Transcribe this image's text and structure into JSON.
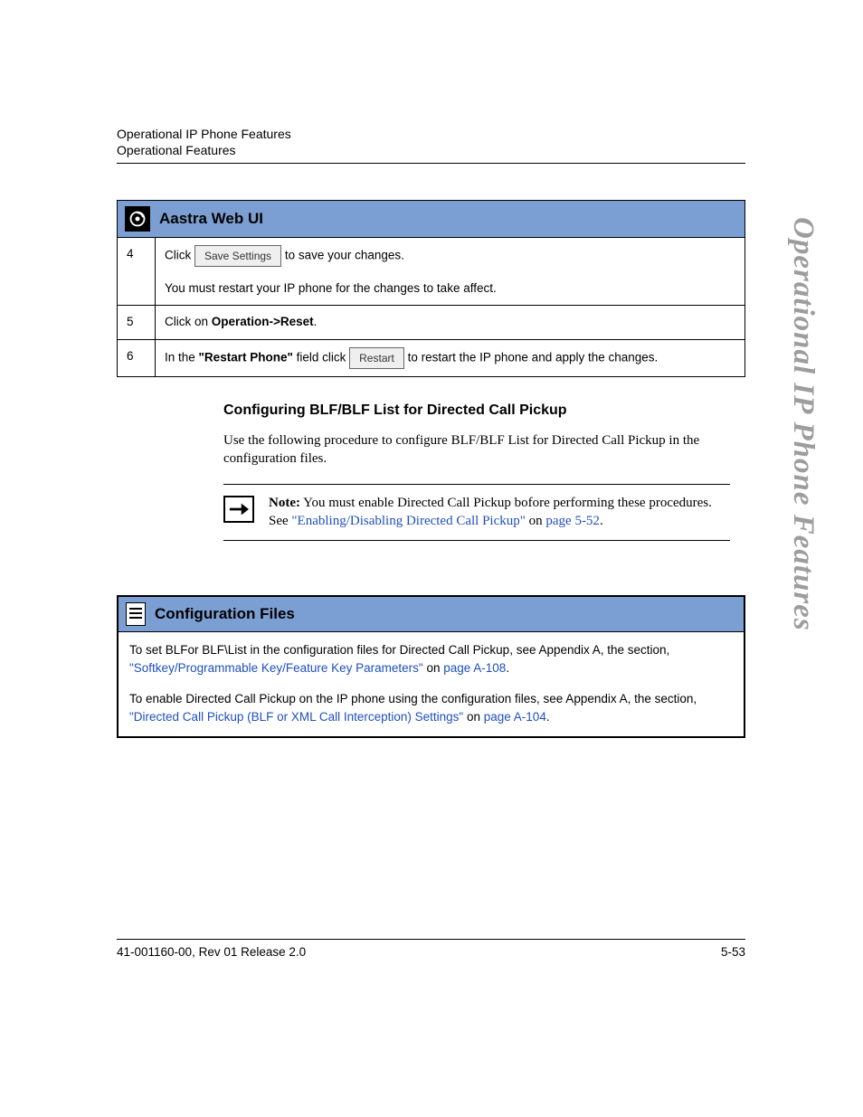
{
  "header": {
    "line1": "Operational IP Phone Features",
    "line2": "Operational Features"
  },
  "side_tab": "Operational IP Phone Features",
  "aastra_table": {
    "title": "Aastra Web UI",
    "rows": [
      {
        "num": "4",
        "prefix": "Click ",
        "button": "Save Settings",
        "after_button": " to save your changes.",
        "second_line": "You must restart your IP phone for the changes to take affect."
      },
      {
        "num": "5",
        "text_before_bold": "Click on ",
        "bold": "Operation->Reset",
        "text_after_bold": "."
      },
      {
        "num": "6",
        "text_before_bold": "In the ",
        "bold": "\"Restart Phone\"",
        "text_after_bold": " field click ",
        "button": "Restart",
        "after_button": " to restart the IP phone and apply the changes."
      }
    ]
  },
  "section": {
    "heading": "Configuring BLF/BLF List for Directed Call Pickup",
    "paragraph": "Use the following procedure to configure BLF/BLF List for Directed Call Pickup in the configuration files."
  },
  "note": {
    "label": "Note:",
    "text_before_link": " You must enable Directed Call Pickup bofore performing these procedures. See ",
    "link1": "\"Enabling/Disabling Directed Call Pickup\"",
    "between": " on ",
    "link2": "page 5-52",
    "after": "."
  },
  "cfg": {
    "title": "Configuration Files",
    "p1_before": "To set BLFor BLF\\List in the configuration files for Directed Call Pickup, see Appendix A, the section, ",
    "p1_link1": "\"Softkey/Programmable Key/Feature Key Parameters\"",
    "p1_between": " on ",
    "p1_link2": "page A-108",
    "p1_after": ".",
    "p2_before": "To enable Directed Call Pickup on the IP phone using the configuration files, see Appendix A, the section, ",
    "p2_link1": "\"Directed Call Pickup (BLF or XML Call Interception) Settings\"",
    "p2_between": " on ",
    "p2_link2": "page A-104",
    "p2_after": "."
  },
  "footer": {
    "left": "41-001160-00, Rev 01  Release 2.0",
    "right": "5-53"
  }
}
